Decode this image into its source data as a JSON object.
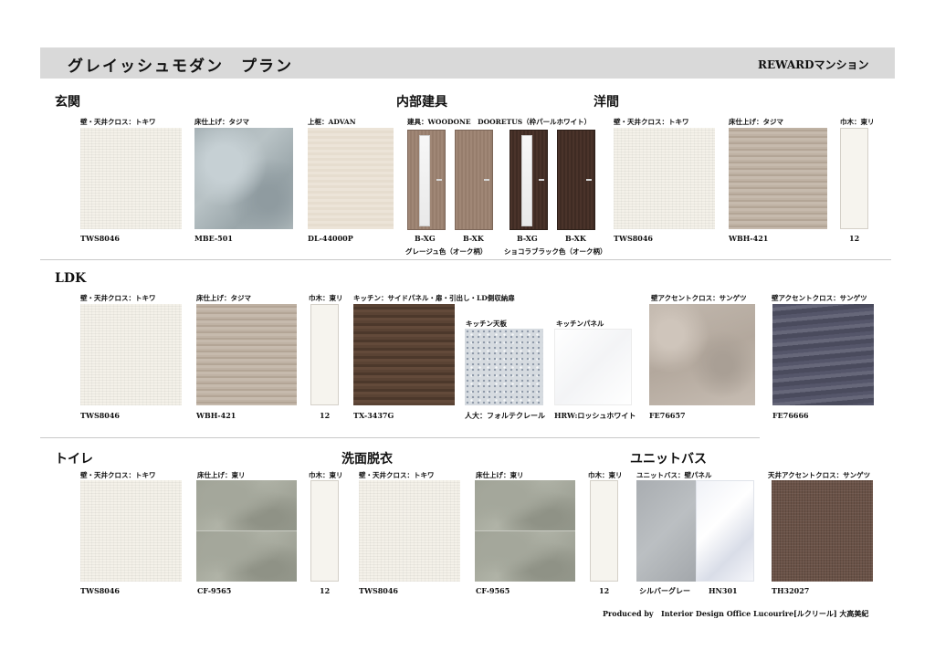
{
  "header": {
    "title": "グレイッシュモダン　プラン",
    "right": "REWARDマンション"
  },
  "sections": {
    "genkan": "玄関",
    "naibu": "内部建具",
    "youma": "洋間",
    "ldk": "LDK",
    "toilet": "トイレ",
    "senmen": "洗面脱衣",
    "bath": "ユニットバス"
  },
  "genkan": {
    "wall_label": "壁・天井クロス：トキワ",
    "wall_code": "TWS8046",
    "floor_label": "床仕上げ：タジマ",
    "floor_code": "MBE-501",
    "frame_label": "上框：ADVAN",
    "frame_code": "DL-44000P"
  },
  "doors": {
    "label": "建具：WOODONE　DOORETUS（枠パールホワイト）",
    "codes": [
      "B-XG",
      "B-XK",
      "B-XG",
      "B-XK"
    ],
    "color1": "グレージュ色（オーク柄）",
    "color2": "ショコラブラック色（オーク柄）"
  },
  "youma": {
    "wall_label": "壁・天井クロス：トキワ",
    "wall_code": "TWS8046",
    "floor_label": "床仕上げ：タジマ",
    "floor_code": "WBH-421",
    "trim_label": "巾木：東リ",
    "trim_code": "12"
  },
  "ldk": {
    "wall_label": "壁・天井クロス：トキワ",
    "wall_code": "TWS8046",
    "floor_label": "床仕上げ：タジマ",
    "floor_code": "WBH-421",
    "trim_label": "巾木：東リ",
    "trim_code": "12",
    "kitchen_label": "キッチン：サイドパネル・扉・引出し・LD側収納扉",
    "kitchen_code": "TX-3437G",
    "top_label": "キッチン天板",
    "top_code": "人大：フォルテクレール",
    "panel_label": "キッチンパネル",
    "panel_code": "HRW:ロッシュホワイト",
    "accent1_label": "壁アクセントクロス：サンゲツ",
    "accent1_code": "FE76657",
    "accent2_label": "壁アクセントクロス：サンゲツ",
    "accent2_code": "FE76666"
  },
  "toilet": {
    "wall_label": "壁・天井クロス：トキワ",
    "wall_code": "TWS8046",
    "floor_label": "床仕上げ：東リ",
    "floor_code": "CF-9565",
    "trim_label": "巾木：東リ",
    "trim_code": "12"
  },
  "senmen": {
    "wall_label": "壁・天井クロス：トキワ",
    "wall_code": "TWS8046",
    "floor_label": "床仕上げ：東リ",
    "floor_code": "CF-9565",
    "trim_label": "巾木：東リ",
    "trim_code": "12"
  },
  "bath": {
    "panel_label": "ユニットバス：壁パネル",
    "panel_code1": "シルバーグレー",
    "panel_code2": "HN301",
    "ceil_label": "天井アクセントクロス：サンゲツ",
    "ceil_code": "TH32027"
  },
  "footer": {
    "produced": "Produced by",
    "office": "Interior Design Office Lucourire[ルクリール] 大高美紀"
  }
}
